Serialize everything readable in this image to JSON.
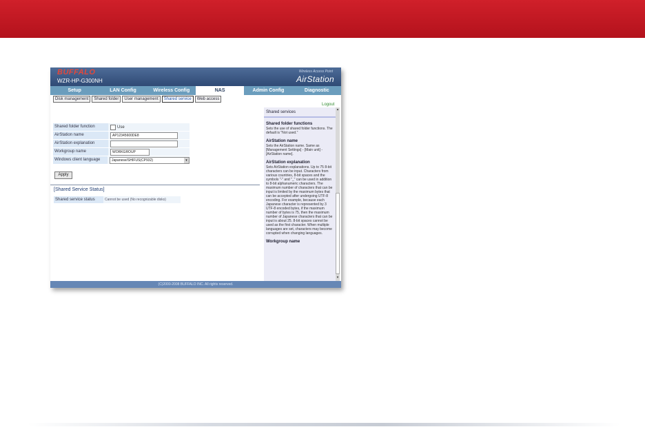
{
  "device": {
    "brand": "BUFFALO",
    "model": "WZR-HP-G300NH",
    "tagline": "Wireless Access Point",
    "product": "AirStation"
  },
  "main_nav": [
    "Setup",
    "LAN Config",
    "Wireless Config",
    "NAS",
    "Admin Config",
    "Diagnostic"
  ],
  "sub_nav": [
    "Disk management",
    "Shared folder",
    "User management",
    "Shared service",
    "Web access"
  ],
  "logout": "Logout",
  "form": {
    "shared_folder_function": {
      "label": "Shared folder function",
      "checkbox_label": "Use"
    },
    "air_station_name": {
      "label": "AirStation name",
      "value": "AP12345600DE8"
    },
    "air_station_explanation": {
      "label": "AirStation explanation",
      "value": ""
    },
    "workgroup_name": {
      "label": "Workgroup name",
      "value": "WORKGROUP"
    },
    "windows_client_language": {
      "label": "Windows client language",
      "value": "Japanese/SHIFUS(CP932)"
    },
    "apply": "Apply"
  },
  "status": {
    "section_title": "[Shared Service Status]",
    "label": "Shared service status",
    "value": "Cannot be used (No recognizable disks)"
  },
  "help": {
    "title": "Shared services",
    "sections": [
      {
        "heading": "Shared folder functions",
        "text": "Sets the use of shared folder functions. The default is \"Not used.\""
      },
      {
        "heading": "AirStation name",
        "text": "Sets the AirStation name. Same as [Management Settings] - [Main unit] - [AirStation name]."
      },
      {
        "heading": "AirStation explanation",
        "text": "Sets AirStation explanations. Up to 75 8-bit characters can be input. Characters from various countries, 8-bit spaces and the symbols \"-\" and \"_\" can be used in addition to 8-bit alphanumeric characters. The maximum number of characters that can be input is limited by the maximum bytes that can be accepted after undergoing UTF-8 encoding. For example, because each Japanese character is represented by 3 UTF-8 encoded bytes, if the maximum number of bytes is 75, then the maximum number of Japanese characters that can be input is about 25. 8-bit spaces cannot be used as the first character. When multiple languages are set, characters may become corrupted when changing languages."
      },
      {
        "heading": "Workgroup name",
        "text": ""
      }
    ]
  },
  "footer": "(C)2000-2008 BUFFALO INC. All rights reserved."
}
